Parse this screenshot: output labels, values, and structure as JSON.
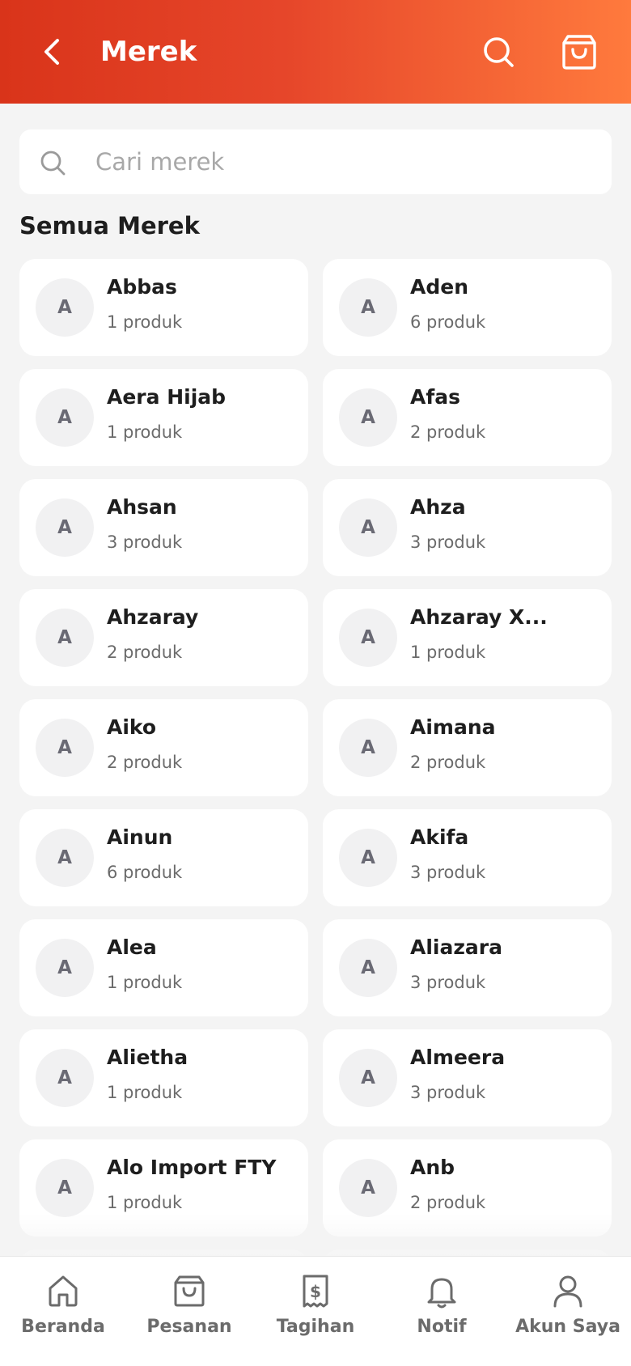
{
  "header": {
    "title": "Merek"
  },
  "search": {
    "placeholder": "Cari merek"
  },
  "section": {
    "title": "Semua Merek"
  },
  "brands": [
    {
      "initial": "A",
      "name": "Abbas",
      "count": "1 produk"
    },
    {
      "initial": "A",
      "name": "Aden",
      "count": "6 produk"
    },
    {
      "initial": "A",
      "name": "Aera Hijab",
      "count": "1 produk"
    },
    {
      "initial": "A",
      "name": "Afas",
      "count": "2 produk"
    },
    {
      "initial": "A",
      "name": "Ahsan",
      "count": "3 produk"
    },
    {
      "initial": "A",
      "name": "Ahza",
      "count": "3 produk"
    },
    {
      "initial": "A",
      "name": "Ahzaray",
      "count": "2 produk"
    },
    {
      "initial": "A",
      "name": "Ahzaray X...",
      "count": "1 produk"
    },
    {
      "initial": "A",
      "name": "Aiko",
      "count": "2 produk"
    },
    {
      "initial": "A",
      "name": "Aimana",
      "count": "2 produk"
    },
    {
      "initial": "A",
      "name": "Ainun",
      "count": "6 produk"
    },
    {
      "initial": "A",
      "name": "Akifa",
      "count": "3 produk"
    },
    {
      "initial": "A",
      "name": "Alea",
      "count": "1 produk"
    },
    {
      "initial": "A",
      "name": "Aliazara",
      "count": "3 produk"
    },
    {
      "initial": "A",
      "name": "Alietha",
      "count": "1 produk"
    },
    {
      "initial": "A",
      "name": "Almeera",
      "count": "3 produk"
    },
    {
      "initial": "A",
      "name": "Alo Import FTY",
      "count": "1 produk"
    },
    {
      "initial": "A",
      "name": "Anb",
      "count": "2 produk"
    }
  ],
  "nav": [
    {
      "label": "Beranda",
      "icon": "home-icon"
    },
    {
      "label": "Pesanan",
      "icon": "bag-icon"
    },
    {
      "label": "Tagihan",
      "icon": "bill-icon"
    },
    {
      "label": "Notif",
      "icon": "bell-icon"
    },
    {
      "label": "Akun Saya",
      "icon": "user-icon"
    }
  ],
  "colors": {
    "header_start": "#d9341a",
    "header_end": "#ff7a3d",
    "background": "#f4f4f4",
    "nav_text": "#6b6b6b"
  }
}
